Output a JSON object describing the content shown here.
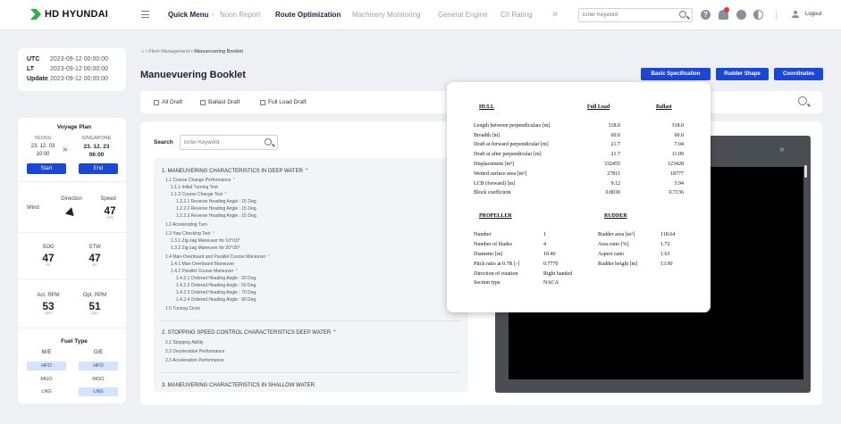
{
  "brand": {
    "logo_text": "HD HYUNDAI",
    "accent": "#2fae4e",
    "primary": "#1a47d6"
  },
  "nav": {
    "items": [
      "Quick Menu",
      "Noon Report",
      "Route Optimization",
      "Machinery Monitoring",
      "General Engine",
      "CII Rating"
    ],
    "separator": "•",
    "more": "»",
    "search_placeholder": "Enter Keyword",
    "help": "?",
    "logout": "Logout"
  },
  "time": {
    "utc_label": "UTC",
    "utc": "2023-09-12 00:00:00",
    "lt_label": "LT",
    "lt": "2023-09-12 00:00:00",
    "update_label": "Update",
    "update": "2023-09-12 00:00:00"
  },
  "voyage": {
    "title": "Voyage Plan",
    "from_port": "YEOSU",
    "from_date": "23. 12. 03",
    "from_time": "10:00",
    "arrow": "»",
    "to_port": "SINGAPORE",
    "to_date": "23. 12. 23",
    "to_time": "06:00",
    "start": "Start",
    "end": "End"
  },
  "wind": {
    "label": "Wind",
    "direction_label": "Direction",
    "speed_label": "Speed",
    "speed": "47",
    "speed_unit": "m/s"
  },
  "speed": {
    "sog_label": "SOG",
    "sog": "47",
    "sog_unit": "kn",
    "stw_label": "STW",
    "stw": "47",
    "stw_unit": "kn"
  },
  "rpm": {
    "act_label": "Act. RPM",
    "act": "53",
    "act_unit": "rpm",
    "opt_label": "Opt. RPM",
    "opt": "51",
    "opt_unit": "rpm"
  },
  "fuel": {
    "title": "Fuel Type",
    "col1": "M/E",
    "col2": "G/E",
    "rows": [
      [
        "HFO",
        "HFO"
      ],
      [
        "MGO",
        "MGO"
      ],
      [
        "LNG",
        "LNG"
      ]
    ],
    "selected": {
      "me": "HFO",
      "ge": [
        "HFO",
        "LNG"
      ]
    }
  },
  "breadcrumb": {
    "home": "⌂",
    "sep": "•",
    "parent": "Fleet Management",
    "current": "Manuevuering Booklet"
  },
  "page": {
    "title": "Manuevuering Booklet",
    "buttons": [
      "Basic Specification",
      "Rudder Shape",
      "Coordinates"
    ]
  },
  "filters": [
    "All Draft",
    "Ballast Draft",
    "Full Load Draft"
  ],
  "search": {
    "label": "Search",
    "placeholder": "Enter Keyword"
  },
  "toc": {
    "section1": "1. MANEUVERING CHARACTERISTICS IN DEEP WATER  ⌃",
    "s1_items": [
      "1.1  Course Change Performance  ⌃",
      "1.1.1  Initial Turning Test",
      "1.1.2  Course Change Test  ⌃",
      "1.2.2.1  Reverse Heading Angle : 15 Deg.",
      "1.2.2.2  Reverse Heading Angle : 15 Deg.",
      "1.2.2.3  Reverse Heading Angle : 15 Deg.",
      "1.2  Accelerating Turn",
      "1.3  Yaw Checking Test  ⌃",
      "1.3.1  Zig-zag Maneuver for 10°/10°",
      "1.3.2  Zig-zag Maneuver for 20°/20°",
      "1.4  Man-Overboard and Parallel Course Maneuver  ⌃",
      "1.4.1  Man-Overboard Maneuver",
      "1.4.2  Parallel Course Maneuver  ⌃",
      "1.4.2.1  Ordered Heading Angle : 20 Deg.",
      "1.4.2.2  Ordered Heading Angle : 50 Deg.",
      "1.4.2.3  Ordered Heading Angle : 70 Deg.",
      "1.4.2.4  Ordered Heading Angle : 90 Deg.",
      "1.5  Turning Circle"
    ],
    "section2": "2. STOPPING SPEED CONTROL CHARACTERISTICS DEEP WATER  ⌃",
    "s2_items": [
      "2.1  Stopping Ability",
      "2.2  Deceleration Performance",
      "2.3  Acceleration Performance"
    ],
    "section3": "3. MANEUVERING CHARACTERISTICS IN SHALLOW WATER"
  },
  "viewer": {
    "chevron": "»"
  },
  "spec": {
    "hull_title": "HULL",
    "col_full": "Full Load",
    "col_ballast": "Ballast",
    "hull_rows": [
      [
        "Length between perpendiculars [m]",
        "318.0",
        "318.0"
      ],
      [
        "Breadth [m]",
        "60.0",
        "60.0"
      ],
      [
        "Draft at forward perpendicular [m]",
        "21.7",
        "7.04"
      ],
      [
        "Draft at after perpendicular [m]",
        "21.7",
        "11.09"
      ],
      [
        "Displacement [m³]",
        "332455",
        "123428"
      ],
      [
        "Wetted surface area [m²]",
        "27811",
        "18777"
      ],
      [
        "LCB (forward) [m]",
        "9.12",
        "5.94"
      ],
      [
        "Block coefficient",
        "0.8030",
        "0.7136"
      ]
    ],
    "propeller_title": "PROPELLER",
    "propeller_rows": [
      [
        "Number",
        "1"
      ],
      [
        "Number of blades",
        "4"
      ],
      [
        "Diameter [m]",
        "10.40"
      ],
      [
        "Pitch ratio at 0.7R [-]",
        "0.7770"
      ],
      [
        "Direction of rotation",
        "Right handed"
      ],
      [
        "Section type",
        "NACA"
      ]
    ],
    "rudder_title": "RUDDER",
    "rudder_rows": [
      [
        "Rudder area [m²]",
        "118.64"
      ],
      [
        "Area ratio [%]",
        "1.72"
      ],
      [
        "Aspect ratio",
        "1.63"
      ],
      [
        "Rudder height [m]",
        "13.90"
      ]
    ]
  }
}
